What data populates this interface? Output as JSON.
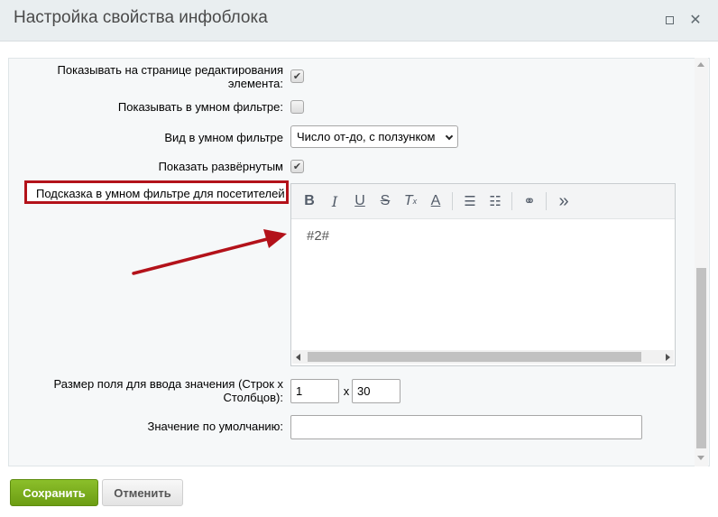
{
  "dialog": {
    "title": "Настройка свойства инфоблока",
    "maximize_icon": "maximize-icon",
    "close_icon": "close-icon"
  },
  "form": {
    "show_on_edit_page_label_line1": "Показывать на странице редактирования",
    "show_on_edit_page_label_line2": "элемента:",
    "show_on_edit_page_checked": true,
    "show_in_smart_filter_label": "Показывать в умном фильтре:",
    "show_in_smart_filter_checked": false,
    "smart_filter_view_label": "Вид в умном фильтре",
    "smart_filter_view_value": "Число от-до, с ползунком",
    "show_expanded_label": "Показать развёрнутым",
    "show_expanded_checked": true,
    "hint_label": "Подсказка в умном фильтре для посетителей",
    "editor_content": "#2#",
    "size_label_line1": "Размер поля для ввода значения (Строк х",
    "size_label_line2": "Столбцов):",
    "rows_value": "1",
    "size_separator": "x",
    "cols_value": "30",
    "default_value_label": "Значение по умолчанию:",
    "default_value": ""
  },
  "editor_toolbar": [
    "bold-icon",
    "italic-icon",
    "underline-icon",
    "strikethrough-icon",
    "clear-format-icon",
    "font-color-icon",
    "ordered-list-icon",
    "unordered-list-icon",
    "link-icon",
    "more-icon"
  ],
  "buttons": {
    "save": "Сохранить",
    "cancel": "Отменить"
  },
  "colors": {
    "highlight": "#b3121a",
    "save_button": "#79ac1c"
  }
}
